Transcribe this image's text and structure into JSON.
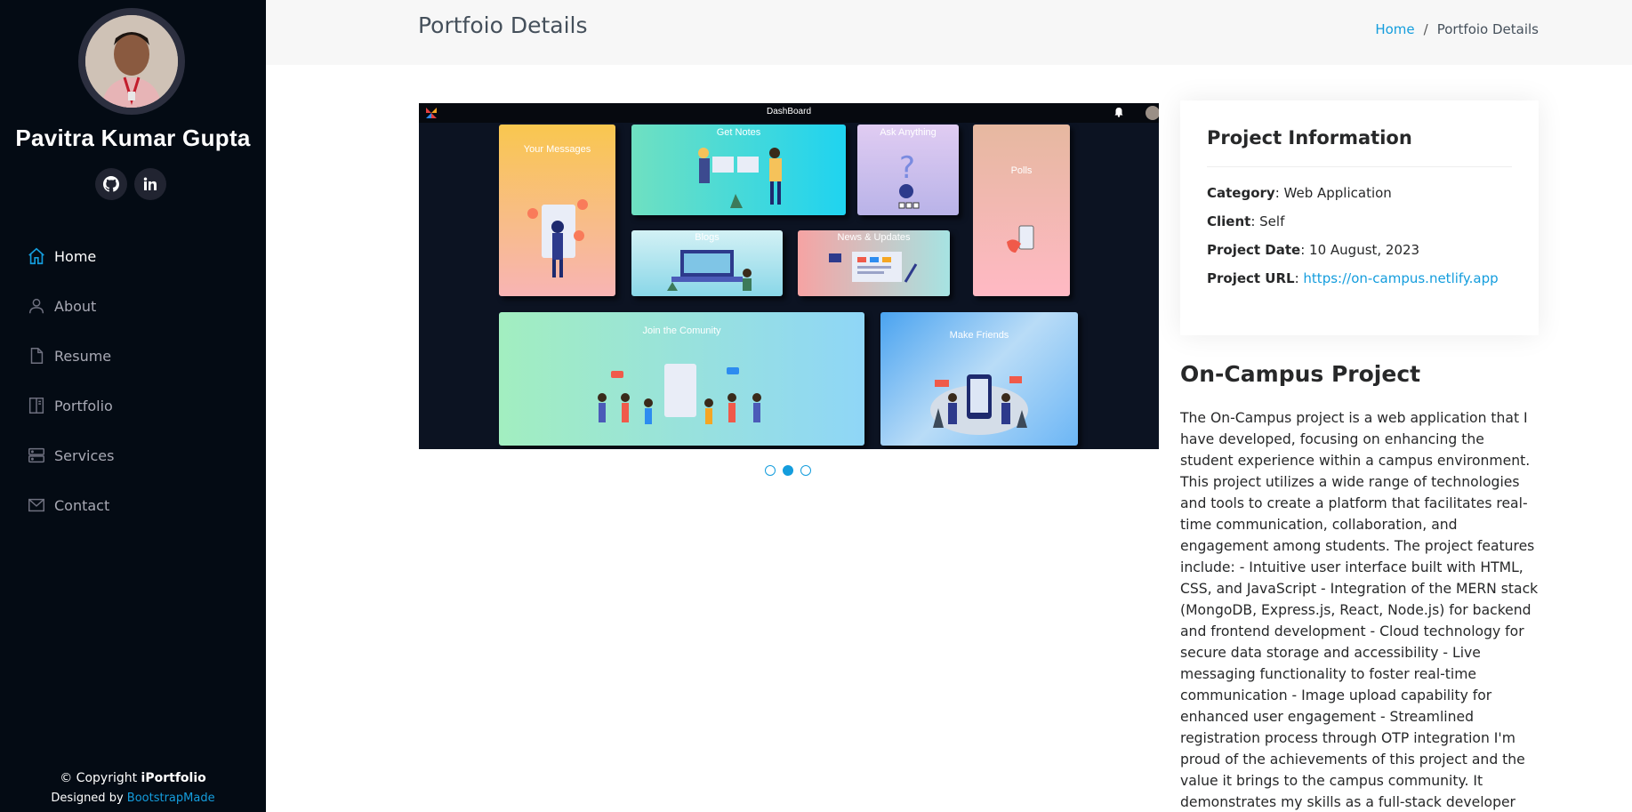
{
  "sidebar": {
    "name": "Pavitra Kumar Gupta",
    "socials": [
      {
        "icon": "github-icon"
      },
      {
        "icon": "linkedin-icon"
      }
    ],
    "nav": [
      {
        "label": "Home",
        "icon": "house-icon",
        "active": true
      },
      {
        "label": "About",
        "icon": "person-icon",
        "active": false
      },
      {
        "label": "Resume",
        "icon": "file-icon",
        "active": false
      },
      {
        "label": "Portfolio",
        "icon": "book-icon",
        "active": false
      },
      {
        "label": "Services",
        "icon": "server-icon",
        "active": false
      },
      {
        "label": "Contact",
        "icon": "envelope-icon",
        "active": false
      }
    ],
    "footer": {
      "copyright_prefix": "© Copyright ",
      "brand": "iPortfolio",
      "designed_prefix": "Designed by ",
      "designer": "BootstrapMade"
    }
  },
  "breadcrumbs": {
    "title": "Portfoio Details",
    "home": "Home",
    "separator": "/",
    "current": "Portfoio Details"
  },
  "slider": {
    "dashboard_title": "DashBoard",
    "cards": [
      {
        "label": "Your Messages"
      },
      {
        "label": "Get Notes"
      },
      {
        "label": "Ask Anything"
      },
      {
        "label": "Polls"
      },
      {
        "label": "Blogs"
      },
      {
        "label": "News & Updates"
      },
      {
        "label": "Join the Comunity"
      },
      {
        "label": "Make Friends"
      }
    ],
    "dot_count": 3,
    "active_dot": 2
  },
  "project_info": {
    "heading": "Project Information",
    "category_label": "Category",
    "category": "Web Application",
    "client_label": "Client",
    "client": "Self",
    "date_label": "Project Date",
    "date": "10 August, 2023",
    "url_label": "Project URL",
    "url": "https://on-campus.netlify.app"
  },
  "description": {
    "title": "On-Campus Project",
    "text": "The On-Campus project is a web application that I have developed, focusing on enhancing the student experience within a campus environment. This project utilizes a wide range of technologies and tools to create a platform that facilitates real-time communication, collaboration, and engagement among students. The project features include: - Intuitive user interface built with HTML, CSS, and JavaScript - Integration of the MERN stack (MongoDB, Express.js, React, Node.js) for backend and frontend development - Cloud technology for secure data storage and accessibility - Live messaging functionality to foster real-time communication - Image upload capability for enhanced user engagement - Streamlined registration process through OTP integration I'm proud of the achievements of this project and the value it brings to the campus community. It demonstrates my skills as a full-stack developer and my commitment to creating practical"
  },
  "colors": {
    "accent": "#149ddd",
    "sidebar_bg": "#040b14",
    "breadcrumb_bg": "#f7f7f7"
  }
}
